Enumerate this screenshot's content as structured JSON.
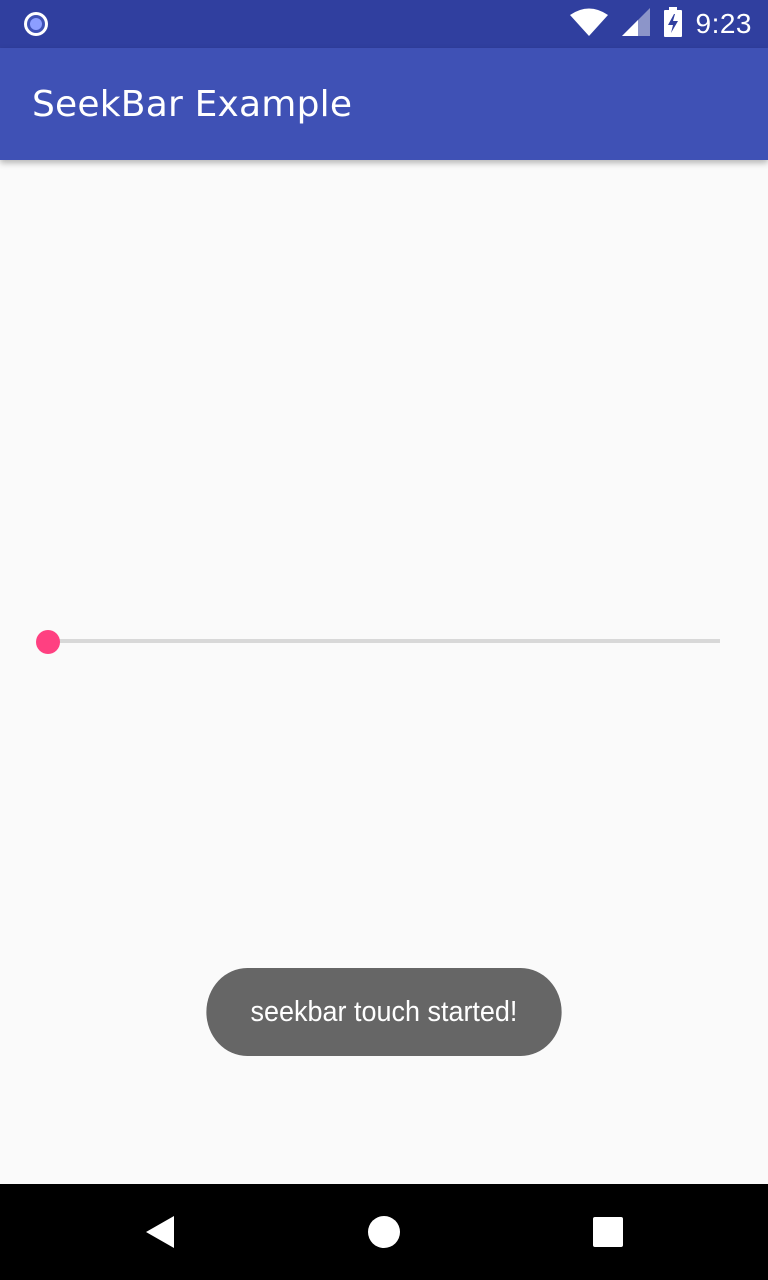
{
  "status_bar": {
    "time": "9:23",
    "icons": [
      "notification-dot-icon",
      "wifi-icon",
      "cell-signal-icon",
      "battery-charging-icon"
    ]
  },
  "app_bar": {
    "title": "SeekBar Example"
  },
  "seekbar": {
    "value": 0,
    "min": 0,
    "max": 100
  },
  "toast": {
    "message": "seekbar touch started!"
  },
  "nav_bar": {
    "icons": [
      "back-icon",
      "home-icon",
      "recents-icon"
    ]
  },
  "colors": {
    "status_bar": "#303f9f",
    "app_bar": "#3f51b5",
    "accent": "#ff4081",
    "toast_bg": "#666666",
    "background": "#fafafa",
    "track": "#d8d8d8"
  }
}
